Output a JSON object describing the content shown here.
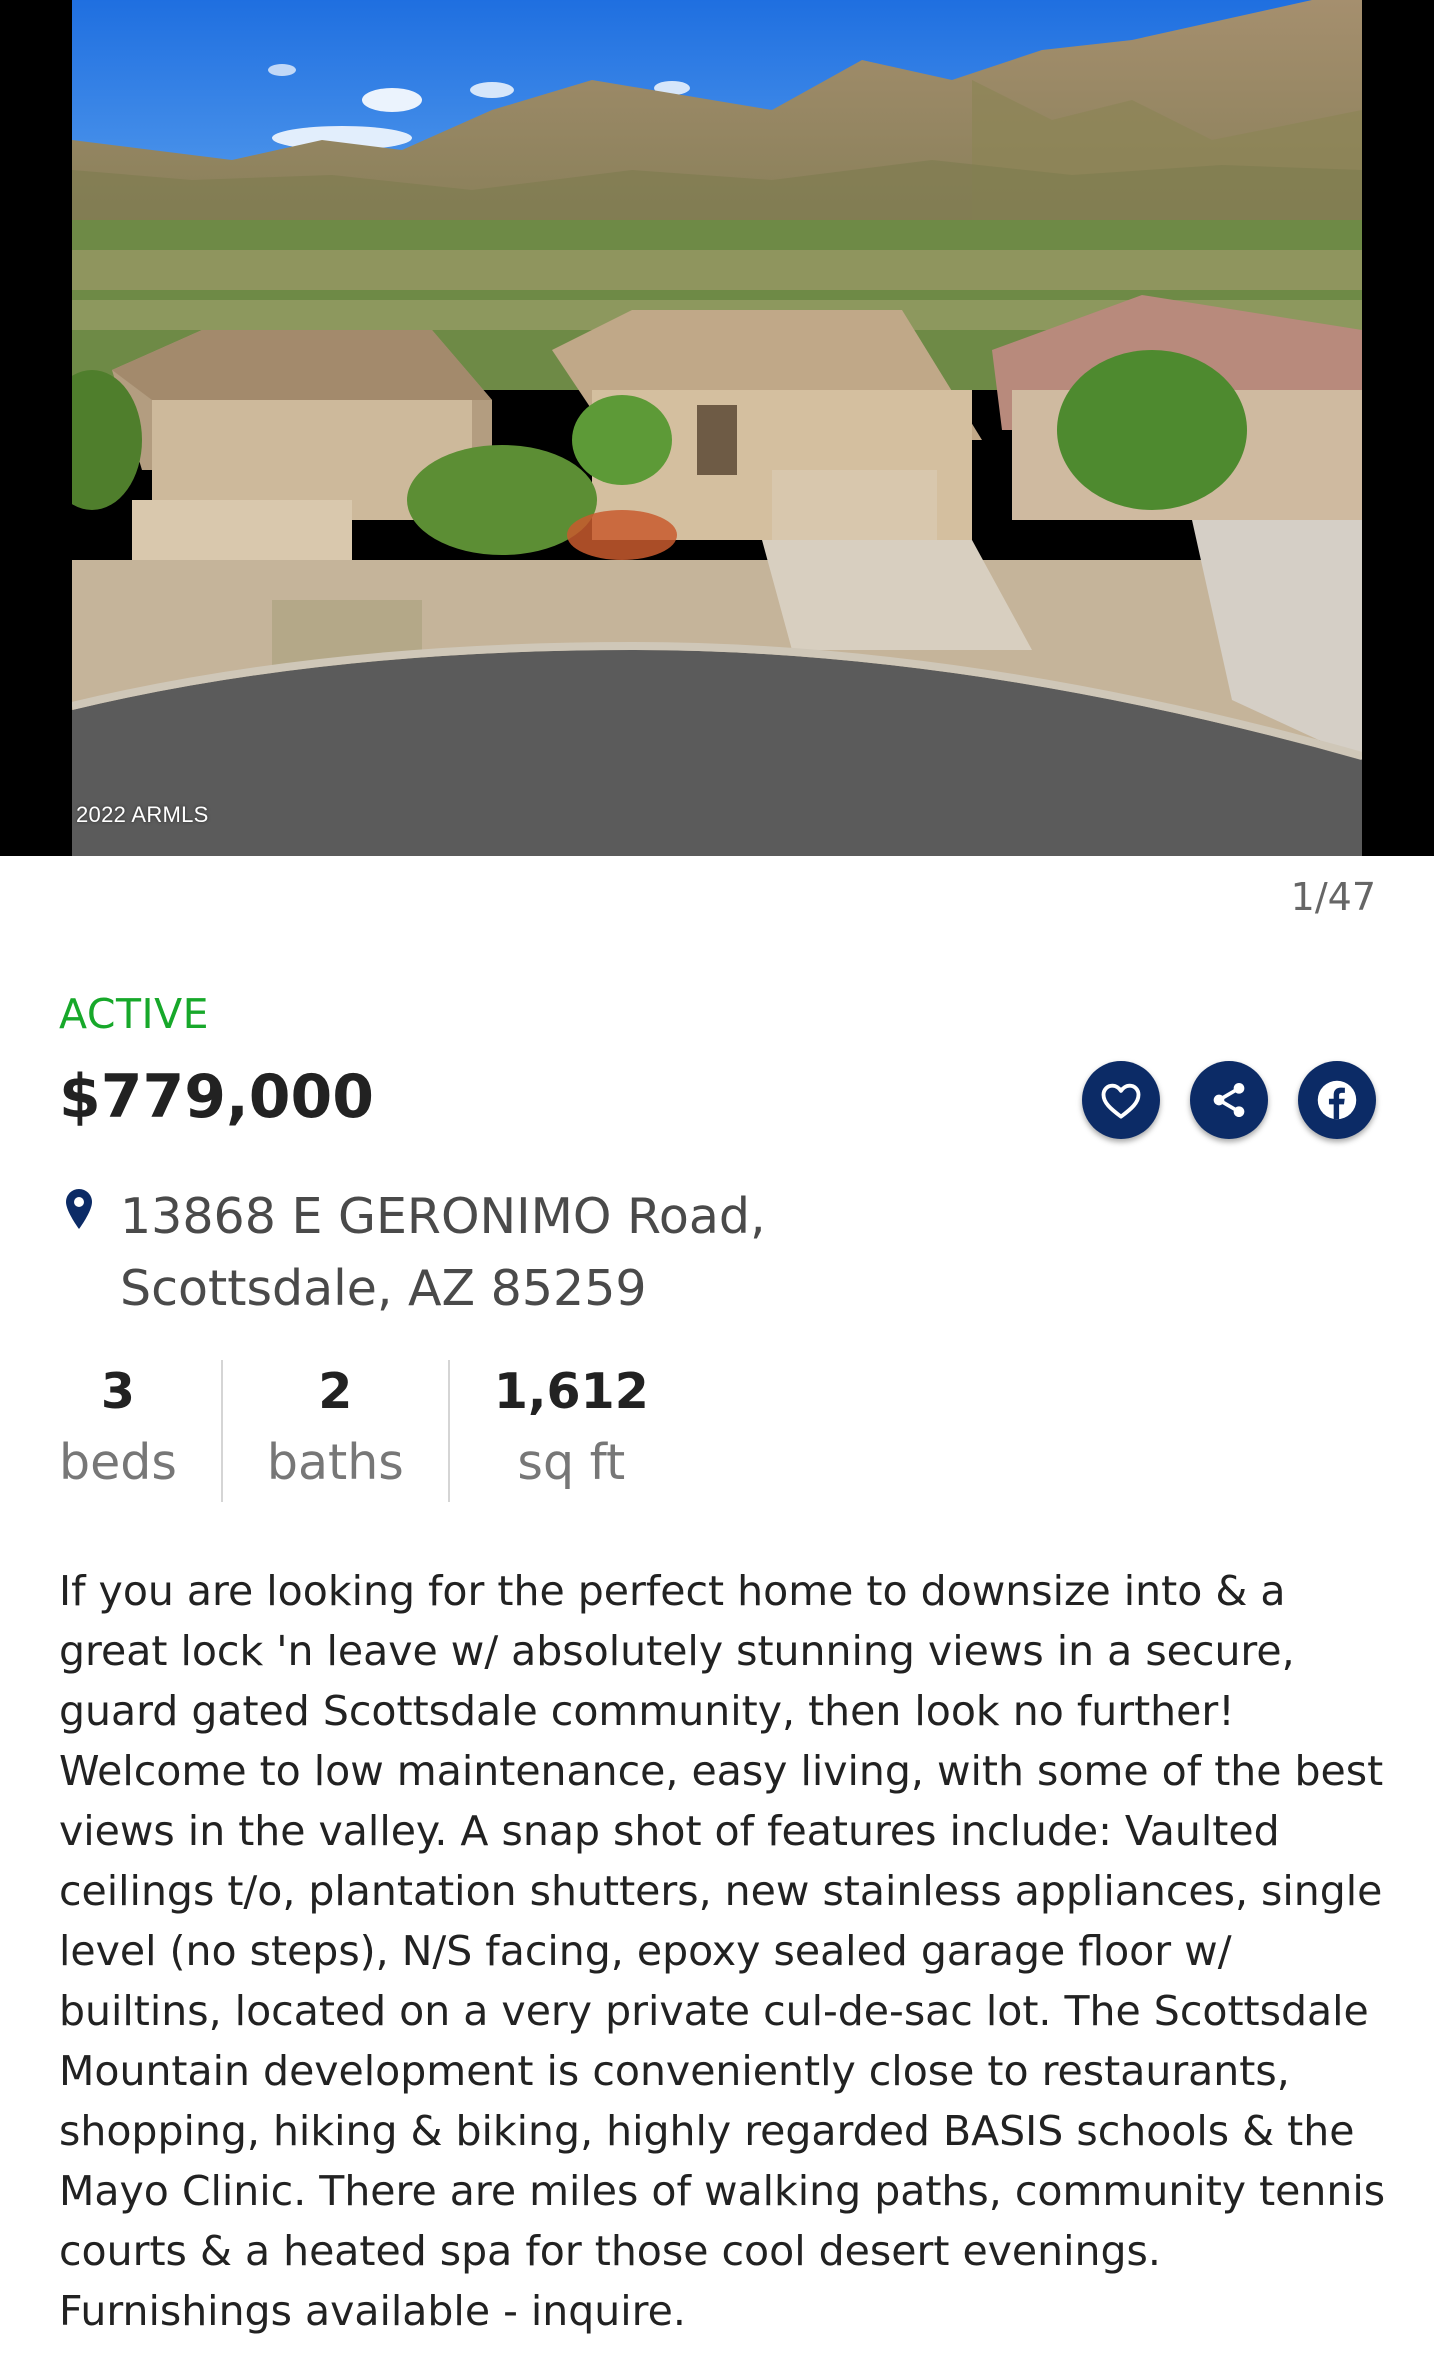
{
  "photo": {
    "watermark": "2022 ARMLS",
    "counter": "1/47",
    "alt": "Aerial view of home in cul-de-sac with desert mountains"
  },
  "listing": {
    "status": "ACTIVE",
    "price": "$779,000",
    "address_line1": "13868 E GERONIMO Road,",
    "address_line2": "Scottsdale, AZ 85259",
    "stats": [
      {
        "value": "3",
        "label": "beds"
      },
      {
        "value": "2",
        "label": "baths"
      },
      {
        "value": "1,612",
        "label": "sq ft"
      }
    ],
    "description": "If you are looking for the perfect home to downsize into & a great lock 'n leave w/ absolutely stunning views in a secure, guard gated Scottsdale community, then look no further! Welcome to low maintenance, easy living, with some of the best views in the valley. A snap shot of features include: Vaulted ceilings t/o, plantation shutters, new stainless appliances, single level (no steps), N/S facing, epoxy sealed garage floor w/ builtins, located on a very private cul-de-sac lot. The Scottsdale Mountain development is conveniently close to restaurants, shopping, hiking & biking, highly regarded BASIS schools & the Mayo Clinic. There are miles of walking paths, community tennis courts & a heated spa for those cool desert evenings. Furnishings available - inquire."
  },
  "actions": {
    "favorite_icon": "heart-icon",
    "share_icon": "share-icon",
    "facebook_icon": "facebook-icon"
  },
  "colors": {
    "status": "#17a82a",
    "action_buttons": "#0c2b66",
    "pin": "#0c2b66"
  }
}
